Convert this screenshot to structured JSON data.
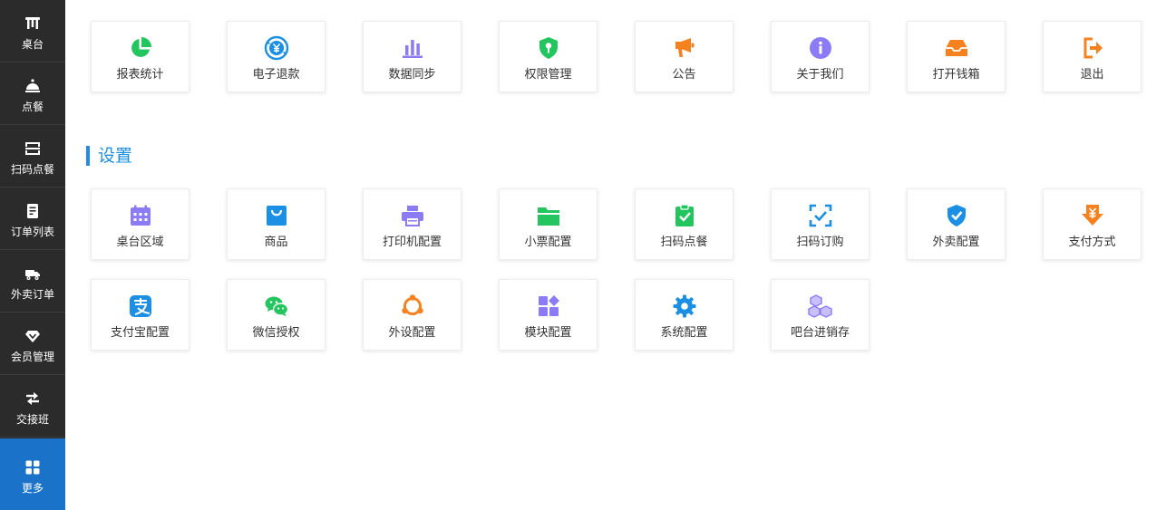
{
  "sidebar": {
    "items": [
      {
        "label": "桌台",
        "icon": "table-icon"
      },
      {
        "label": "点餐",
        "icon": "cloche-icon"
      },
      {
        "label": "扫码点餐",
        "icon": "scan-icon"
      },
      {
        "label": "订单列表",
        "icon": "order-list-icon"
      },
      {
        "label": "外卖订单",
        "icon": "delivery-truck-icon"
      },
      {
        "label": "会员管理",
        "icon": "diamond-icon"
      },
      {
        "label": "交接班",
        "icon": "swap-icon"
      },
      {
        "label": "更多",
        "icon": "grid-icon",
        "active": true
      }
    ],
    "active_color": "#1a73c9",
    "background": "#2b2b2b"
  },
  "top_row": [
    {
      "label": "报表统计",
      "icon": "pie-chart-icon",
      "color": "#22c55e"
    },
    {
      "label": "电子退款",
      "icon": "yen-refresh-icon",
      "color": "#1a8fe3"
    },
    {
      "label": "数据同步",
      "icon": "bar-chart-icon",
      "color": "#8b7cf6"
    },
    {
      "label": "权限管理",
      "icon": "shield-key-icon",
      "color": "#22c55e"
    },
    {
      "label": "公告",
      "icon": "megaphone-icon",
      "color": "#f5821f"
    },
    {
      "label": "关于我们",
      "icon": "info-icon",
      "color": "#8b7cf6"
    },
    {
      "label": "打开钱箱",
      "icon": "cash-drawer-icon",
      "color": "#f5821f"
    },
    {
      "label": "退出",
      "icon": "logout-icon",
      "color": "#f5821f"
    }
  ],
  "settings": {
    "title": "设置",
    "color": "#1a8fe3",
    "items": [
      {
        "label": "桌台区域",
        "icon": "calendar-icon",
        "color": "#8b7cf6"
      },
      {
        "label": "商品",
        "icon": "shopping-bag-icon",
        "color": "#1a8fe3"
      },
      {
        "label": "打印机配置",
        "icon": "printer-icon",
        "color": "#8b7cf6"
      },
      {
        "label": "小票配置",
        "icon": "folder-icon",
        "color": "#22c55e"
      },
      {
        "label": "扫码点餐",
        "icon": "clipboard-check-icon",
        "color": "#22c55e"
      },
      {
        "label": "扫码订购",
        "icon": "scan-check-icon",
        "color": "#1a8fe3"
      },
      {
        "label": "外卖配置",
        "icon": "shield-check-icon",
        "color": "#1a8fe3"
      },
      {
        "label": "支付方式",
        "icon": "yen-arrow-icon",
        "color": "#f5821f"
      },
      {
        "label": "支付宝配置",
        "icon": "alipay-icon",
        "color": "#1a8fe3"
      },
      {
        "label": "微信授权",
        "icon": "wechat-icon",
        "color": "#22c55e"
      },
      {
        "label": "外设配置",
        "icon": "peripheral-icon",
        "color": "#f5821f"
      },
      {
        "label": "模块配置",
        "icon": "modules-icon",
        "color": "#8b7cf6"
      },
      {
        "label": "系统配置",
        "icon": "gear-icon",
        "color": "#1a8fe3"
      },
      {
        "label": "吧台进销存",
        "icon": "boxes-icon",
        "color": "#8b7cf6"
      }
    ]
  }
}
